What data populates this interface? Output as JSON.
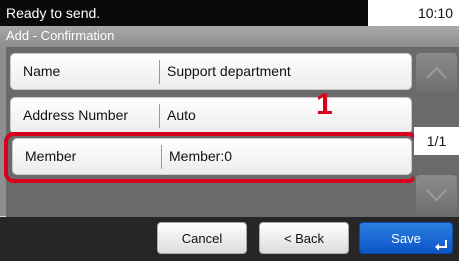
{
  "status": {
    "message": "Ready to send.",
    "time": "10:10"
  },
  "screen": {
    "title": "Add - Confirmation"
  },
  "rows": [
    {
      "label": "Name",
      "value": "Support department"
    },
    {
      "label": "Address Number",
      "value": "Auto"
    },
    {
      "label": "Member",
      "value": "Member:0"
    }
  ],
  "callout": "1",
  "pager": {
    "indicator": "1/1"
  },
  "buttons": {
    "cancel": "Cancel",
    "back": "< Back",
    "save": "Save"
  },
  "colors": {
    "highlight": "#d8001c",
    "accent": "#0b55c8"
  }
}
